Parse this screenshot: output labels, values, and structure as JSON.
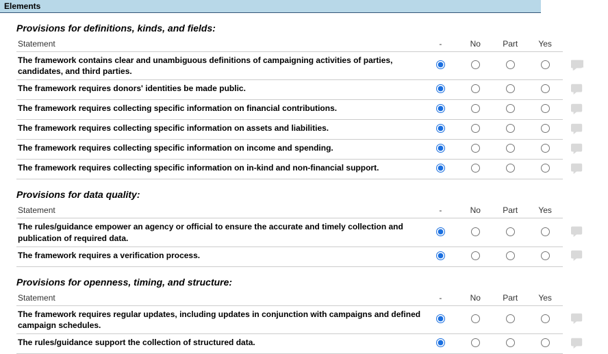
{
  "tab": "Elements",
  "columns": {
    "statement": "Statement",
    "dash": "-",
    "no": "No",
    "part": "Part",
    "yes": "Yes"
  },
  "sections": [
    {
      "heading": "Provisions for definitions, kinds, and fields:",
      "rows": [
        {
          "text": "The framework contains clear and unambiguous definitions of campaigning activities of parties, candidates, and third parties.",
          "selected": "dash"
        },
        {
          "text": "The framework requires donors' identities be made public.",
          "selected": "dash"
        },
        {
          "text": "The framework requires collecting specific information on financial contributions.",
          "selected": "dash"
        },
        {
          "text": "The framework requires collecting specific information on assets and liabilities.",
          "selected": "dash"
        },
        {
          "text": "The framework requires collecting specific information on income and spending.",
          "selected": "dash"
        },
        {
          "text": "The framework requires collecting specific information on in-kind and non-financial support.",
          "selected": "dash"
        }
      ]
    },
    {
      "heading": "Provisions for data quality:",
      "rows": [
        {
          "text": "The rules/guidance empower an agency or official to ensure the accurate and timely collection and publication of required data.",
          "selected": "dash"
        },
        {
          "text": "The framework requires a verification process.",
          "selected": "dash"
        }
      ]
    },
    {
      "heading": "Provisions for openness, timing, and structure:",
      "rows": [
        {
          "text": "The framework requires regular updates, including updates in conjunction with campaigns and defined campaign schedules.",
          "selected": "dash"
        },
        {
          "text": "The rules/guidance support the collection of structured data.",
          "selected": "dash"
        }
      ]
    }
  ]
}
